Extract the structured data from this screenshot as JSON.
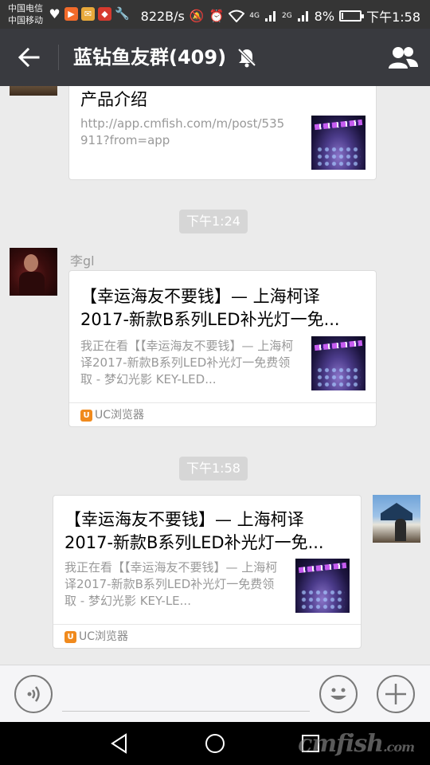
{
  "status_bar": {
    "carrier_1": "中国电信",
    "carrier_2": "中国移动",
    "network_speed": "822B/s",
    "signal_1_label": "4G",
    "signal_2_label": "2G",
    "battery_percent": "8%",
    "battery_level": 0.08,
    "time": "下午1:58",
    "icons": [
      "heart-rate-icon",
      "video-app-icon",
      "notification-app-icon",
      "red-app-icon",
      "wrench-icon",
      "mute-icon",
      "alarm-icon",
      "wifi-icon",
      "signal-icon",
      "battery-icon"
    ]
  },
  "header": {
    "title": "蓝钻鱼友群(409)",
    "back_icon": "arrow-left-icon",
    "mute_icon": "bell-off-icon",
    "members_icon": "group-icon",
    "colors": {
      "bar": "#393a3f",
      "status": "#353535"
    }
  },
  "messages": [
    {
      "type": "link-card",
      "title": "产品介绍",
      "desc": "http://app.cmfish.com/m/post/535911?from=app"
    },
    {
      "type": "time",
      "text": "下午1:24"
    },
    {
      "type": "link-card",
      "sender": "李gl",
      "title_line_1": "【幸运海友不要钱】— 上海柯译",
      "title_line_2": "2017-新款B系列LED补光灯一免...",
      "desc": "我正在看【【幸运海友不要钱】— 上海柯译2017-新款B系列LED补光灯一免费领取 - 梦幻光影 KEY-LED...",
      "source": "UC浏览器"
    },
    {
      "type": "time",
      "text": "下午1:58"
    },
    {
      "type": "link-card",
      "sender": "self",
      "title_line_1": "【幸运海友不要钱】— 上海柯译",
      "title_line_2": "2017-新款B系列LED补光灯一免...",
      "desc": "我正在看【【幸运海友不要钱】— 上海柯译2017-新款B系列LED补光灯一免费领取 - 梦幻光影 KEY-LE...",
      "source": "UC浏览器"
    }
  ],
  "input_bar": {
    "placeholder": "",
    "voice_icon": "voice-icon",
    "emoji_icon": "emoji-icon",
    "plus_icon": "plus-icon"
  },
  "nav_bar": {
    "icons": [
      "back-triangle-icon",
      "home-circle-icon",
      "recents-square-icon"
    ],
    "watermark_main": "cmfish",
    "watermark_suffix": ".com"
  }
}
